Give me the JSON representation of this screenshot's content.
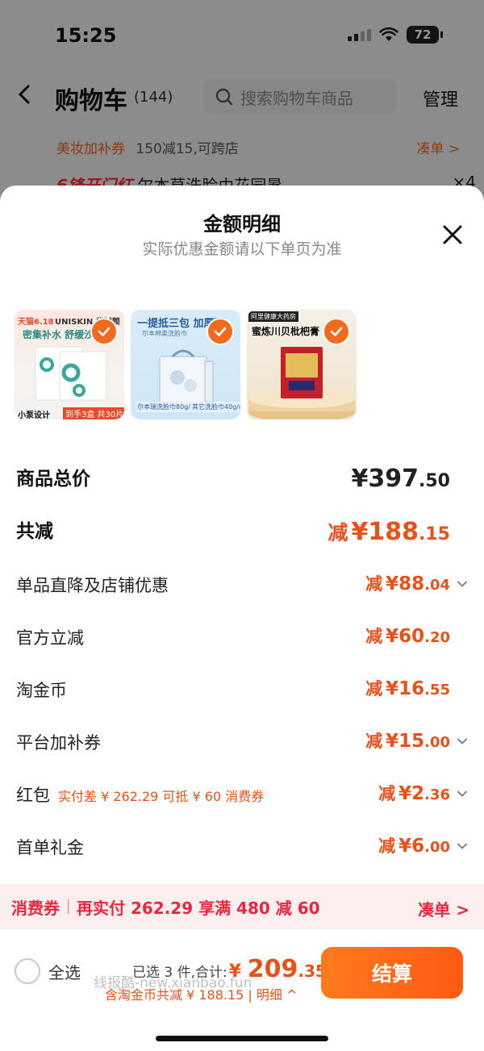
{
  "status_bar": {
    "time": "15:25",
    "battery": "72"
  },
  "background_page": {
    "title": "购物车",
    "count": "(144)",
    "search_placeholder": "搜索购物车商品",
    "manage_label": "管理",
    "promo_tag": "美妆加补券",
    "promo_text": "150减15,可跨店",
    "promo_link": "凑单 >",
    "peek_red": "6锋开门红",
    "peek_text": "尔本草洗脸巾花园暑",
    "peek_qty": "×4"
  },
  "sheet": {
    "title": "金额明细",
    "subtitle": "实际优惠金额请以下单页为准"
  },
  "thumbnails": [
    {
      "line1": "天猫6.18",
      "line2": "UNISKIN 优时颜",
      "line3": "密集补水 舒缓沙",
      "footer": "小泵设计",
      "badge": "到手3盒 共30片"
    },
    {
      "line1": "一提抵三包 加厚更",
      "line2": "尔本棉柔洗脸巾",
      "footer_a": "尔本瑞洗脸巾80g/m²",
      "footer_b": "其它洗脸巾40g/m²"
    },
    {
      "line1": "阿里健康大药房",
      "line2": "蜜炼川贝枇杷膏"
    }
  ],
  "summary": {
    "total_label": "商品总价",
    "total_value": "¥397",
    "total_cents": ".50",
    "discount_label": "共减",
    "discount_prefix": "减",
    "discount_value": "¥188",
    "discount_cents": ".15"
  },
  "details": [
    {
      "label": "单品直降及店铺优惠",
      "prefix": "减",
      "value": "¥88",
      "cents": ".04"
    },
    {
      "label": "官方立减",
      "prefix": "减",
      "value": "¥60",
      "cents": ".20"
    },
    {
      "label": "淘金币",
      "prefix": "减",
      "value": "¥16",
      "cents": ".55"
    },
    {
      "label": "平台加补券",
      "prefix": "减",
      "value": "¥15",
      "cents": ".00"
    },
    {
      "label": "红包",
      "note": "实付差 ¥ 262.29 可抵 ¥ 60 消费券",
      "prefix": "减",
      "value": "¥2",
      "cents": ".36"
    },
    {
      "label": "首单礼金",
      "prefix": "减",
      "value": "¥6",
      "cents": ".00"
    }
  ],
  "voucher_bar": {
    "tag": "消费券",
    "text": "再实付 262.29 享满 480 减 60",
    "link": "凑单 >"
  },
  "bottom": {
    "select_all": "全选",
    "selected": "已选 3 件,",
    "total_label": "合计:",
    "total_symbol": "¥",
    "total_int": "209",
    "total_cents": ".35",
    "detail_line": "含淘金币共减 ¥ 188.15 | 明细 ^",
    "watermark": "线报酷-new.xianbao.fun",
    "checkout": "结算"
  },
  "colors": {
    "accent": "#e8521a",
    "voucher_red": "#e8273d",
    "check_orange": "#f26b1d"
  }
}
